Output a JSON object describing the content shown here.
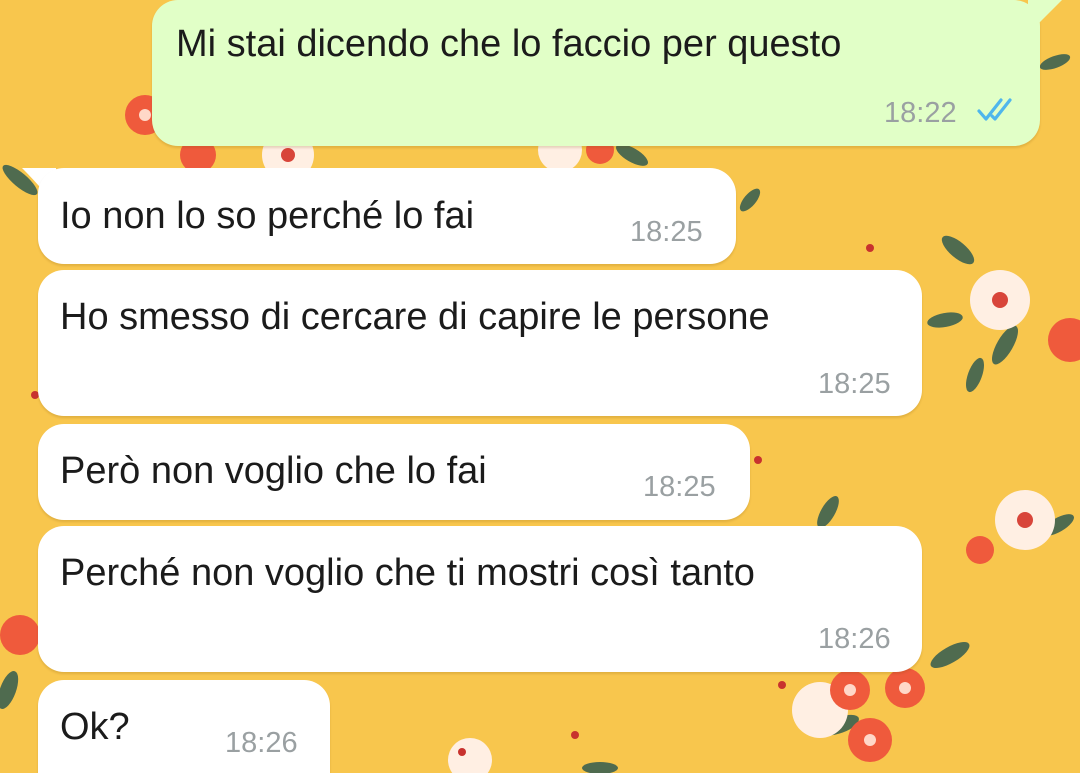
{
  "chat": {
    "messages": [
      {
        "direction": "outgoing",
        "text": "Mi stai dicendo che lo faccio per questo",
        "time": "18:22",
        "status_icon": "double-check-read-icon"
      },
      {
        "direction": "incoming",
        "text": "Io non lo so perché lo fai",
        "time": "18:25"
      },
      {
        "direction": "incoming",
        "text": "Ho smesso di cercare di capire le persone",
        "time": "18:25"
      },
      {
        "direction": "incoming",
        "text": "Però non voglio che lo fai",
        "time": "18:25"
      },
      {
        "direction": "incoming",
        "text": "Perché non voglio che ti mostri così tanto",
        "time": "18:26"
      },
      {
        "direction": "incoming",
        "text": "Ok?",
        "time": "18:26"
      }
    ]
  },
  "colors": {
    "wallpaper": "#f8c64d",
    "outgoing_bubble": "#e1ffc7",
    "incoming_bubble": "#ffffff",
    "read_ticks": "#4fb6ec",
    "timestamp": "#9aa0a2"
  }
}
